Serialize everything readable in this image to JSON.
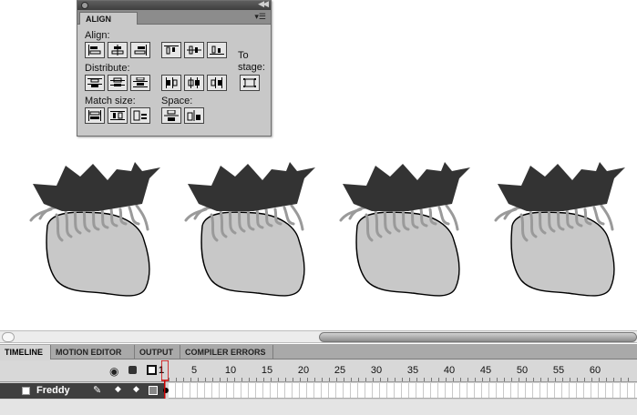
{
  "align_panel": {
    "tab_label": "ALIGN",
    "align_label": "Align:",
    "distribute_label": "Distribute:",
    "match_size_label": "Match size:",
    "space_label": "Space:",
    "to_stage_label_line1": "To",
    "to_stage_label_line2": "stage:"
  },
  "timeline": {
    "tabs": [
      "TIMELINE",
      "MOTION EDITOR",
      "OUTPUT",
      "COMPILER ERRORS"
    ],
    "active_tab": "TIMELINE",
    "current_frame": "1",
    "frame_numbers": [
      "5",
      "10",
      "15",
      "20",
      "25",
      "30",
      "35",
      "40",
      "45",
      "50",
      "55",
      "60"
    ],
    "layer_name": "Freddy"
  },
  "colors": {
    "hair": "#333333",
    "face": "#c8c8c8",
    "curls": "#9a9a9a",
    "layer_bg": "#3f3f3f"
  }
}
